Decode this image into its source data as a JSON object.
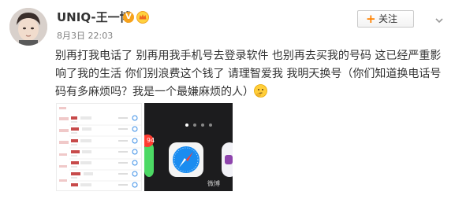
{
  "user": {
    "name": "UNIQ-王一博",
    "verified_mark": "V"
  },
  "post": {
    "timestamp": "8月3日 22:03",
    "lines": [
      "别再打我电话了 别再用我手机号去登录软件 也别再去买我的号码 这已经严重影",
      "响了我的生活 你们别浪费这个钱了 请理智爱我 我明天换号（你们知道换电话号",
      "码有多麻烦吗？我是一个最嫌麻烦的人）"
    ]
  },
  "follow_button": {
    "plus": "+",
    "label": "关注"
  },
  "images": {
    "screenshot2_badge": "94",
    "watermark": "微博"
  },
  "icons": {
    "avatar": "avatar",
    "emoji": "thinking-face-icon",
    "chevron": "chevron-down-icon"
  },
  "colors": {
    "accent_orange": "#ff8200",
    "verified_badge": "#f7a21b",
    "timestamp_gray": "#808080"
  }
}
